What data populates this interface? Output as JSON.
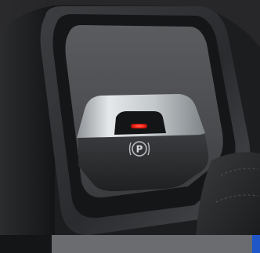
{
  "scene": {
    "subject": "electronic-parking-brake-switch",
    "symbol": "P",
    "indicator_color": "#ff2a1c",
    "trim_color": "#1c1d1f",
    "surround_color": "#5a5b5e",
    "bezel_color": "#c8cdd1",
    "button_color": "#2b2c2f",
    "bottom_band_color": "#6a6c70",
    "corner_accent_color": "#1f57c9"
  }
}
